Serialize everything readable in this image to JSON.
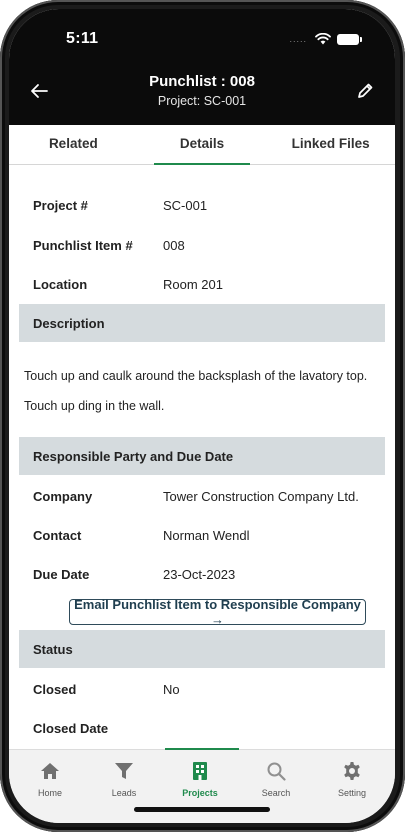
{
  "status_bar": {
    "time": "5:11",
    "signal": "....."
  },
  "header": {
    "title": "Punchlist : 008",
    "subtitle": "Project: SC-001"
  },
  "tabs": [
    {
      "label": "Related",
      "active": false
    },
    {
      "label": "Details",
      "active": true
    },
    {
      "label": "Linked Files",
      "active": false
    }
  ],
  "details": {
    "project_label": "Project #",
    "project_value": "SC-001",
    "item_label": "Punchlist Item #",
    "item_value": "008",
    "location_label": "Location",
    "location_value": "Room 201"
  },
  "description": {
    "heading": "Description",
    "line1": "Touch up and caulk around the backsplash of the lavatory top.",
    "line2": "Touch up ding in the wall."
  },
  "responsible": {
    "heading": "Responsible Party and Due Date",
    "company_label": "Company",
    "company_value": "Tower Construction Company Ltd.",
    "contact_label": "Contact",
    "contact_value": "Norman Wendl",
    "due_label": "Due Date",
    "due_value": "23-Oct-2023",
    "email_button": "Email Punchlist Item to Responsible Company →"
  },
  "status": {
    "heading": "Status",
    "closed_label": "Closed",
    "closed_value": "No",
    "closed_date_label": "Closed Date",
    "closed_date_value": ""
  },
  "bottom_nav": [
    {
      "label": "Home",
      "icon": "home-icon"
    },
    {
      "label": "Leads",
      "icon": "filter-icon"
    },
    {
      "label": "Projects",
      "icon": "building-icon",
      "active": true
    },
    {
      "label": "Search",
      "icon": "search-icon"
    },
    {
      "label": "Setting",
      "icon": "gear-icon"
    }
  ],
  "colors": {
    "accent": "#1f8a4c",
    "section_bg": "#d5dbde",
    "header_bg": "#0b0b0b",
    "button_border": "#2f4b5a"
  }
}
